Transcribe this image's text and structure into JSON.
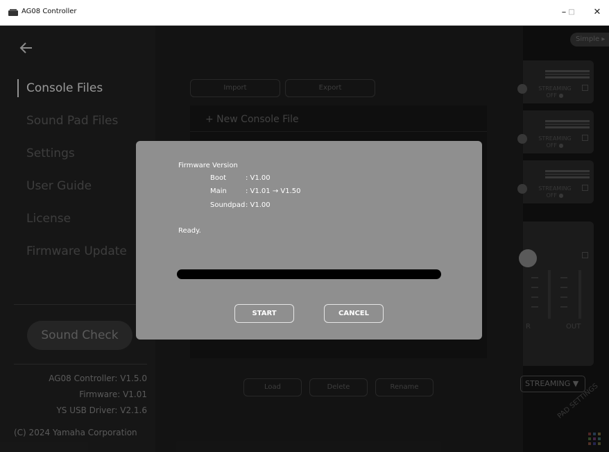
{
  "window": {
    "title": "AG08 Controller",
    "minimize_glyph": "–",
    "maximize_glyph": "□",
    "close_glyph": "✕"
  },
  "sidebar": {
    "items": [
      {
        "label": "Console Files",
        "active": true
      },
      {
        "label": "Sound Pad Files",
        "active": false
      },
      {
        "label": "Settings",
        "active": false
      },
      {
        "label": "User Guide",
        "active": false
      },
      {
        "label": "License",
        "active": false
      },
      {
        "label": "Firmware Update",
        "active": false
      }
    ],
    "sound_check_label": "Sound Check",
    "info": {
      "controller": "AG08 Controller: V1.5.0",
      "firmware": "Firmware:  V1.01",
      "driver": "YS USB Driver: V2.1.6"
    },
    "copyright": "(C) 2024 Yamaha Corporation"
  },
  "main": {
    "import_label": "Import",
    "export_label": "Export",
    "new_file_label": "+ New Console File",
    "load_label": "Load",
    "delete_label": "Delete",
    "rename_label": "Rename"
  },
  "right_panel": {
    "simple_label": "Simple ▸",
    "streaming_lines": [
      "STREAMING",
      "OFF ●"
    ],
    "streaming_dropdown": "STREAMING ▼",
    "pad_settings": "PAD SETTINGS",
    "out_label": "OUT",
    "r_label": "R"
  },
  "dialog": {
    "firmware_version_label": "Firmware Version",
    "boot_label": "Boot",
    "boot_value": ": V1.00",
    "main_label": "Main",
    "main_value": ": V1.01 → V1.50",
    "soundpad_label": "Soundpad",
    "soundpad_value": ": V1.00",
    "status": "Ready.",
    "progress": 0,
    "start_label": "START",
    "cancel_label": "CANCEL"
  },
  "colors": {
    "dialog_bg": "#8f8f8f",
    "sidebar_bg": "#232323",
    "progress_track": "#000000"
  }
}
